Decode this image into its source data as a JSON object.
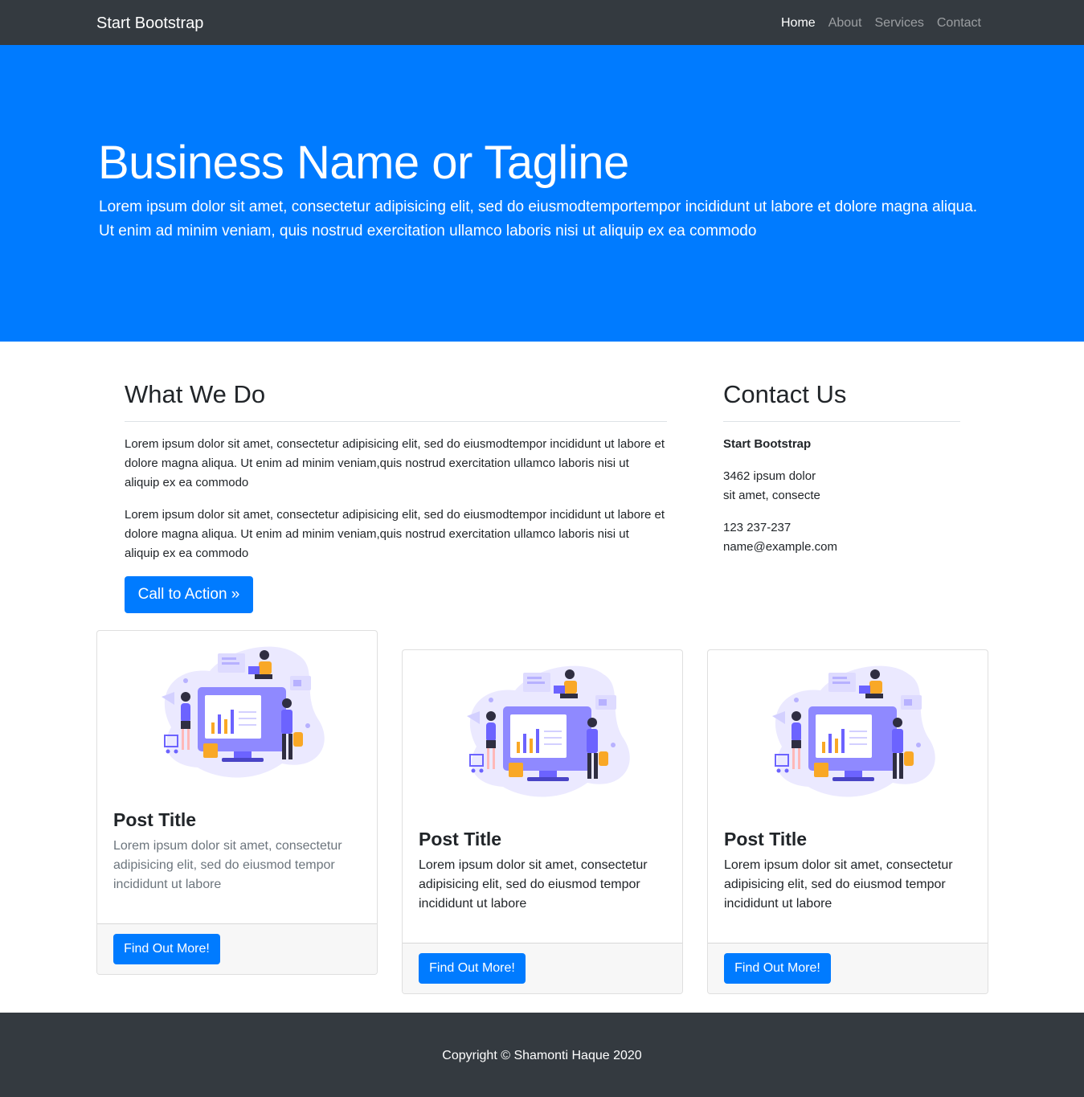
{
  "navbar": {
    "brand": "Start Bootstrap",
    "links": [
      "Home",
      "About",
      "Services",
      "Contact"
    ]
  },
  "hero": {
    "title": "Business Name or Tagline",
    "lead": "Lorem ipsum dolor sit amet, consectetur adipisicing elit, sed do eiusmodtemportempor incididunt ut labore et dolore magna aliqua. Ut enim ad minim veniam, quis nostrud exercitation ullamco laboris nisi ut aliquip ex ea commodo"
  },
  "what_we_do": {
    "heading": "What We Do",
    "paragraphs": [
      "Lorem ipsum dolor sit amet, consectetur adipisicing elit, sed do eiusmodtempor incididunt ut labore et dolore magna aliqua. Ut enim ad minim veniam,quis nostrud exercitation ullamco laboris nisi ut aliquip ex ea commodo",
      "Lorem ipsum dolor sit amet, consectetur adipisicing elit, sed do eiusmodtempor incididunt ut labore et dolore magna aliqua. Ut enim ad minim veniam,quis nostrud exercitation ullamco laboris nisi ut aliquip ex ea commodo"
    ],
    "cta": "Call to Action »"
  },
  "contact": {
    "heading": "Contact Us",
    "name": "Start Bootstrap",
    "address_line1": "3462 ipsum dolor",
    "address_line2": "sit amet, consecte",
    "phone": "123 237-237",
    "email": "name@example.com"
  },
  "cards": [
    {
      "title": "Post Title",
      "text": "Lorem ipsum dolor sit amet, consectetur adipisicing elit, sed do eiusmod tempor incididunt ut labore",
      "button": "Find Out More!"
    },
    {
      "title": "Post Title",
      "text": "Lorem ipsum dolor sit amet, consectetur adipisicing elit, sed do eiusmod tempor incididunt ut labore",
      "button": "Find Out More!"
    },
    {
      "title": "Post Title",
      "text": "Lorem ipsum dolor sit amet, consectetur adipisicing elit, sed do eiusmod tempor incididunt ut labore",
      "button": "Find Out More!"
    }
  ],
  "footer": {
    "copyright": "Copyright © Shamonti Haque 2020"
  },
  "colors": {
    "primary": "#007bff",
    "dark": "#343a40",
    "illustration_purple": "#6c63ff",
    "illustration_orange": "#f9a826"
  }
}
